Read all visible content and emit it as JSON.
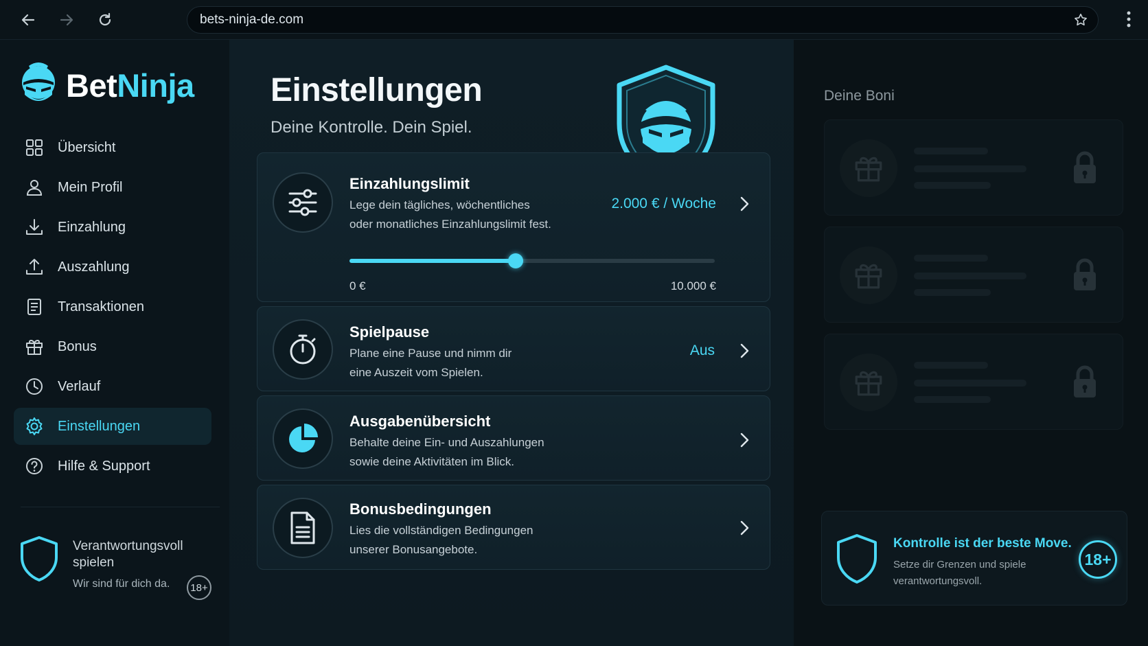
{
  "browser": {
    "url": "bets-ninja-de.com",
    "icons": [
      "back-arrow-icon",
      "forward-arrow-icon",
      "reload-icon",
      "star-icon",
      "menu-dots-icon"
    ]
  },
  "brand": {
    "name_part1": "Bet",
    "name_part2": "Ninja",
    "accent_color": "#4ad8f4"
  },
  "sidebar": {
    "items": [
      {
        "label": "Übersicht",
        "icon": "grid-icon",
        "active": false
      },
      {
        "label": "Mein Profil",
        "icon": "user-icon",
        "active": false
      },
      {
        "label": "Einzahlung",
        "icon": "download-icon",
        "active": false
      },
      {
        "label": "Auszahlung",
        "icon": "upload-icon",
        "active": false
      },
      {
        "label": "Transaktionen",
        "icon": "document-icon",
        "active": false
      },
      {
        "label": "Bonus",
        "icon": "gift-icon",
        "active": false
      },
      {
        "label": "Verlauf",
        "icon": "clock-icon",
        "active": false
      },
      {
        "label": "Einstellungen",
        "icon": "gear-icon",
        "active": true
      },
      {
        "label": "Hilfe & Support",
        "icon": "help-icon",
        "active": false
      }
    ],
    "responsible": {
      "title": "Verantwortungsvoll spielen",
      "subtitle": "Wir sind für dich da.",
      "age_badge": "18+"
    }
  },
  "main": {
    "title": "Einstellungen",
    "subtitle": "Deine Kontrolle. Dein Spiel.",
    "cards": [
      {
        "title": "Einzahlungslimit",
        "desc_line1": "Lege dein tägliches, wöchentliches",
        "desc_line2": "oder monatliches Einzahlungslimit fest.",
        "value": "2.000 € / Woche",
        "icon": "sliders-icon",
        "slider": {
          "min_label": "0 €",
          "max_label": "10.000 €",
          "fraction": 0.455
        }
      },
      {
        "title": "Spielpause",
        "desc_line1": "Plane eine Pause und nimm dir",
        "desc_line2": "eine Auszeit vom Spielen.",
        "value": "Aus",
        "icon": "stopwatch-icon"
      },
      {
        "title": "Ausgabenübersicht",
        "desc_line1": "Behalte deine Ein- und Auszahlungen",
        "desc_line2": "sowie deine Aktivitäten im Blick.",
        "value": "",
        "icon": "pie-chart-icon"
      },
      {
        "title": "Bonusbedingungen",
        "desc_line1": "Lies die vollständigen Bedingungen",
        "desc_line2": "unserer Bonusangebote.",
        "value": "",
        "icon": "file-text-icon"
      }
    ]
  },
  "right_panel": {
    "title": "Deine Boni",
    "bonus_slots": 3,
    "promo": {
      "title": "Kontrolle ist der beste Move.",
      "subtitle": "Setze dir Grenzen und spiele verantwortungsvoll.",
      "age_badge": "18+"
    }
  }
}
